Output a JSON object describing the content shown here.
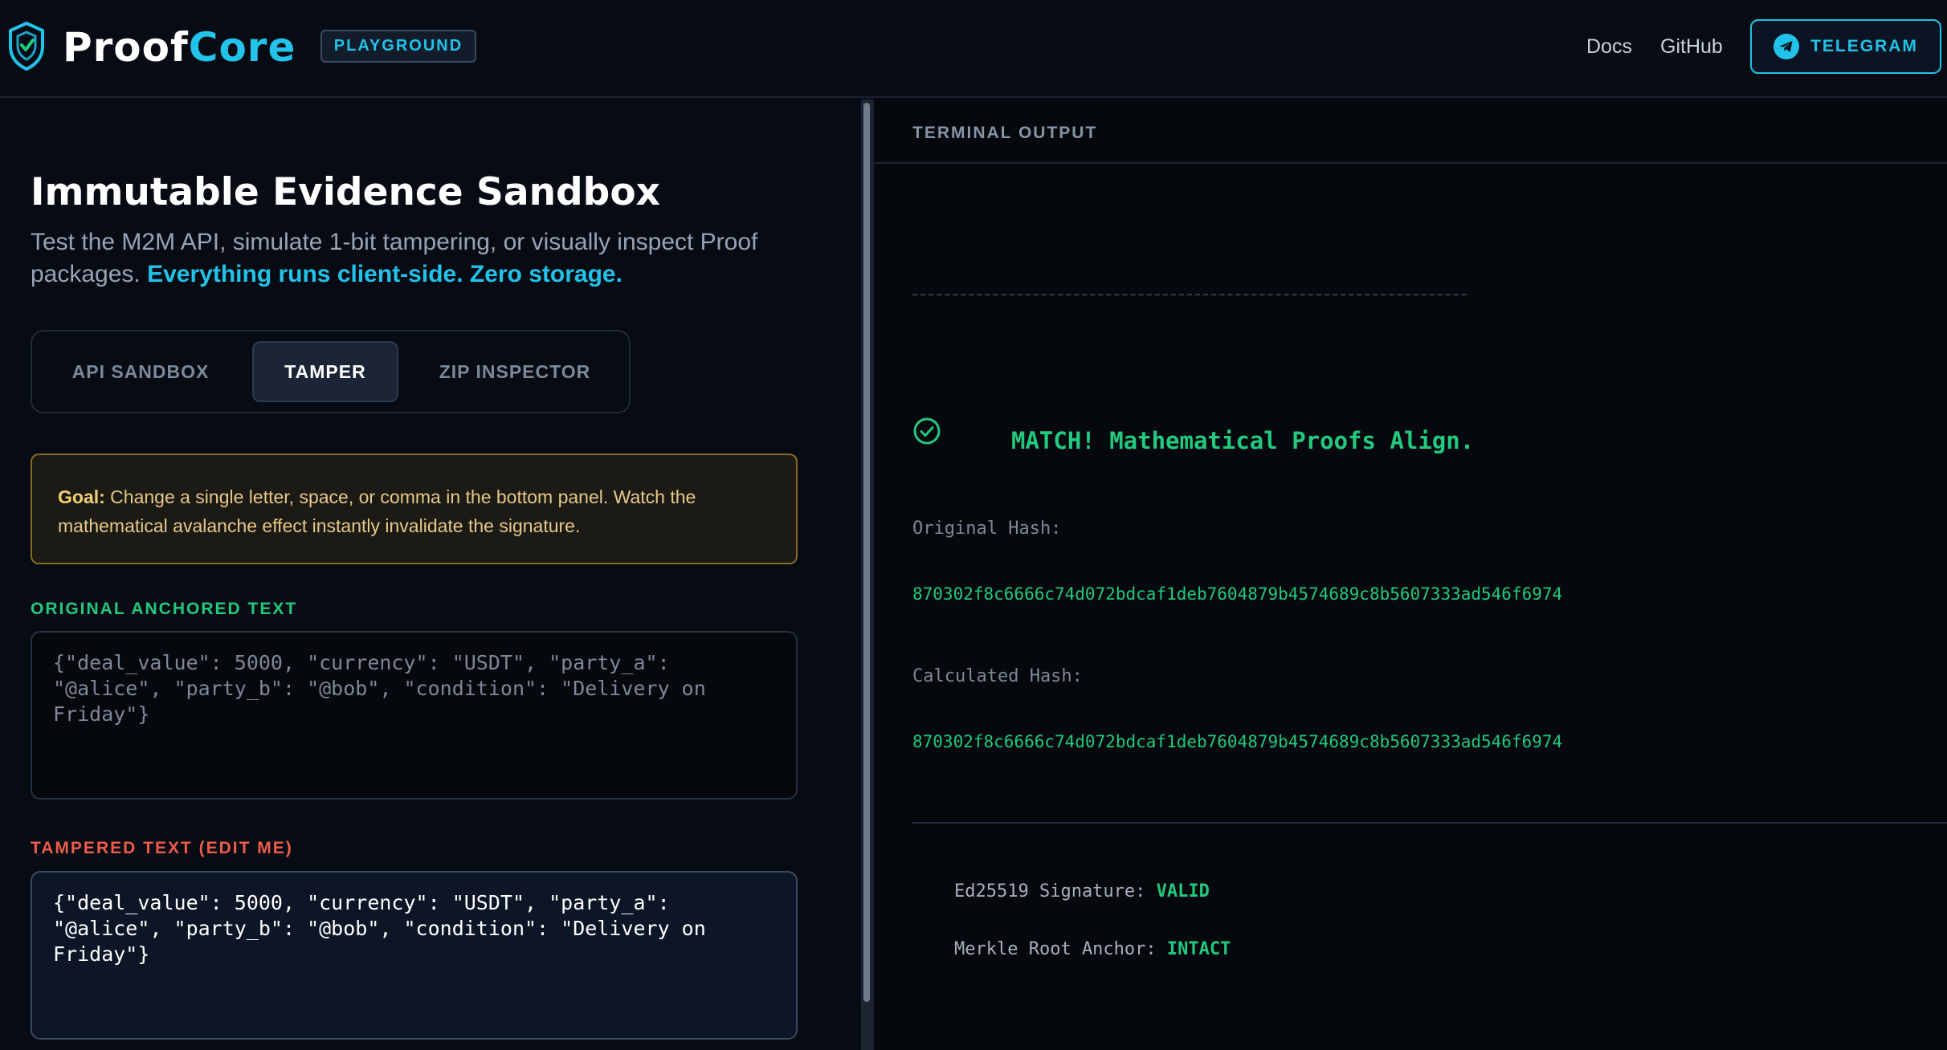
{
  "header": {
    "logo_proof": "Proof",
    "logo_core": "Core",
    "badge": "PLAYGROUND",
    "nav": {
      "docs": "Docs",
      "github": "GitHub",
      "telegram": "TELEGRAM"
    }
  },
  "left": {
    "title": "Immutable Evidence Sandbox",
    "description": "Test the M2M API, simulate 1-bit tampering, or visually inspect Proof packages.",
    "description_highlight": "Everything runs client-side. Zero storage.",
    "tabs": [
      {
        "label": "API SANDBOX",
        "active": false
      },
      {
        "label": "TAMPER",
        "active": true
      },
      {
        "label": "ZIP INSPECTOR",
        "active": false
      }
    ],
    "goal": {
      "prefix": "Goal:",
      "text": "Change a single letter, space, or comma in the bottom panel. Watch the mathematical avalanche effect instantly invalidate the signature."
    },
    "original_label": "ORIGINAL ANCHORED TEXT",
    "original_text": "{\"deal_value\": 5000, \"currency\": \"USDT\", \"party_a\": \"@alice\", \"party_b\": \"@bob\", \"condition\": \"Delivery on Friday\"}",
    "tampered_label": "TAMPERED TEXT (EDIT ME)",
    "tampered_text": "{\"deal_value\": 5000, \"currency\": \"USDT\", \"party_a\": \"@alice\", \"party_b\": \"@bob\", \"condition\": \"Delivery on Friday\"}"
  },
  "terminal": {
    "title": "TERMINAL OUTPUT",
    "match_text": "MATCH! Mathematical Proofs Align.",
    "original_hash_label": "Original Hash:",
    "original_hash": "870302f8c6666c74d072bdcaf1deb7604879b4574689c8b5607333ad546f6974",
    "calculated_hash_label": "Calculated Hash:",
    "calculated_hash": "870302f8c6666c74d072bdcaf1deb7604879b4574689c8b5607333ad546f6974",
    "signature_label": "Ed25519 Signature:",
    "signature_value": "VALID",
    "merkle_label": "Merkle Root Anchor:",
    "merkle_value": "INTACT"
  },
  "colors": {
    "accent": "#22c3ea",
    "success": "#22c97e",
    "warning": "#e6c88a",
    "danger": "#ef5c4c"
  },
  "icons": [
    "shield-logo-icon",
    "telegram-icon",
    "check-circle-icon"
  ]
}
